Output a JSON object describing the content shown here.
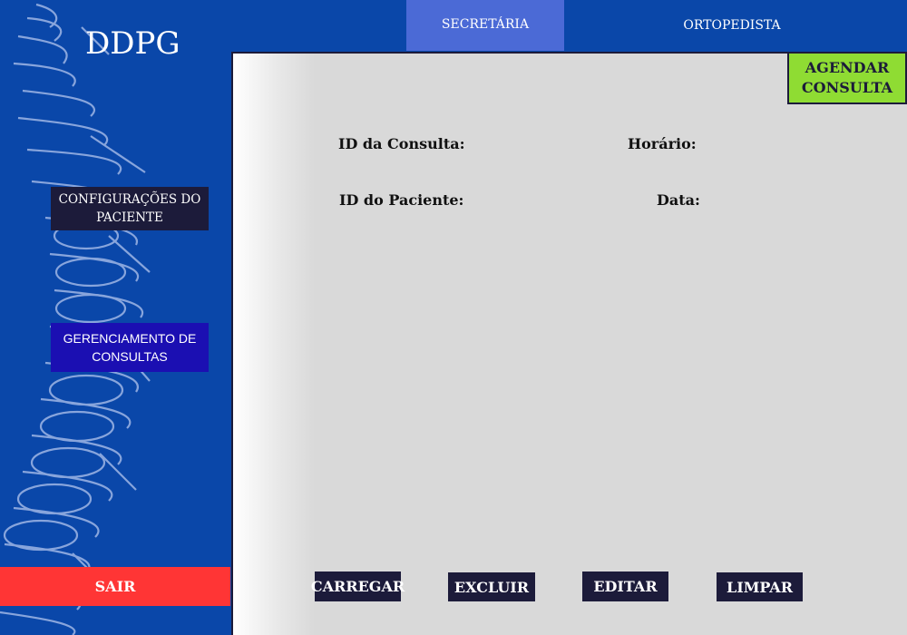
{
  "app": {
    "logo": "DDPG"
  },
  "tabs": [
    {
      "label": "SECRETÁRIA",
      "active": true
    },
    {
      "label": "ORTOPEDISTA",
      "active": false
    }
  ],
  "sidebar": {
    "items": [
      {
        "label": "CONFIGURAÇÕES DO PACIENTE"
      },
      {
        "label": "GERENCIAMENTO DE CONSULTAS"
      }
    ],
    "logout_label": "SAIR"
  },
  "main": {
    "schedule_button": "AGENDAR CONSULTA",
    "fields": {
      "consult_id": "ID da Consulta:",
      "time": "Horário:",
      "patient_id": "ID do Paciente:",
      "date": "Data:"
    },
    "actions": {
      "load": "CARREGAR",
      "delete": "EXCLUIR",
      "edit": "EDITAR",
      "clear": "LIMPAR"
    }
  },
  "colors": {
    "background": "#0a47a9",
    "active_tab": "#4b6ad6",
    "dark_button": "#1c1b3a",
    "logout": "#ff3535",
    "schedule": "#8fdc33",
    "panel": "#d9d9d9"
  },
  "icons": {
    "sidebar_decoration": "spine-illustration"
  }
}
